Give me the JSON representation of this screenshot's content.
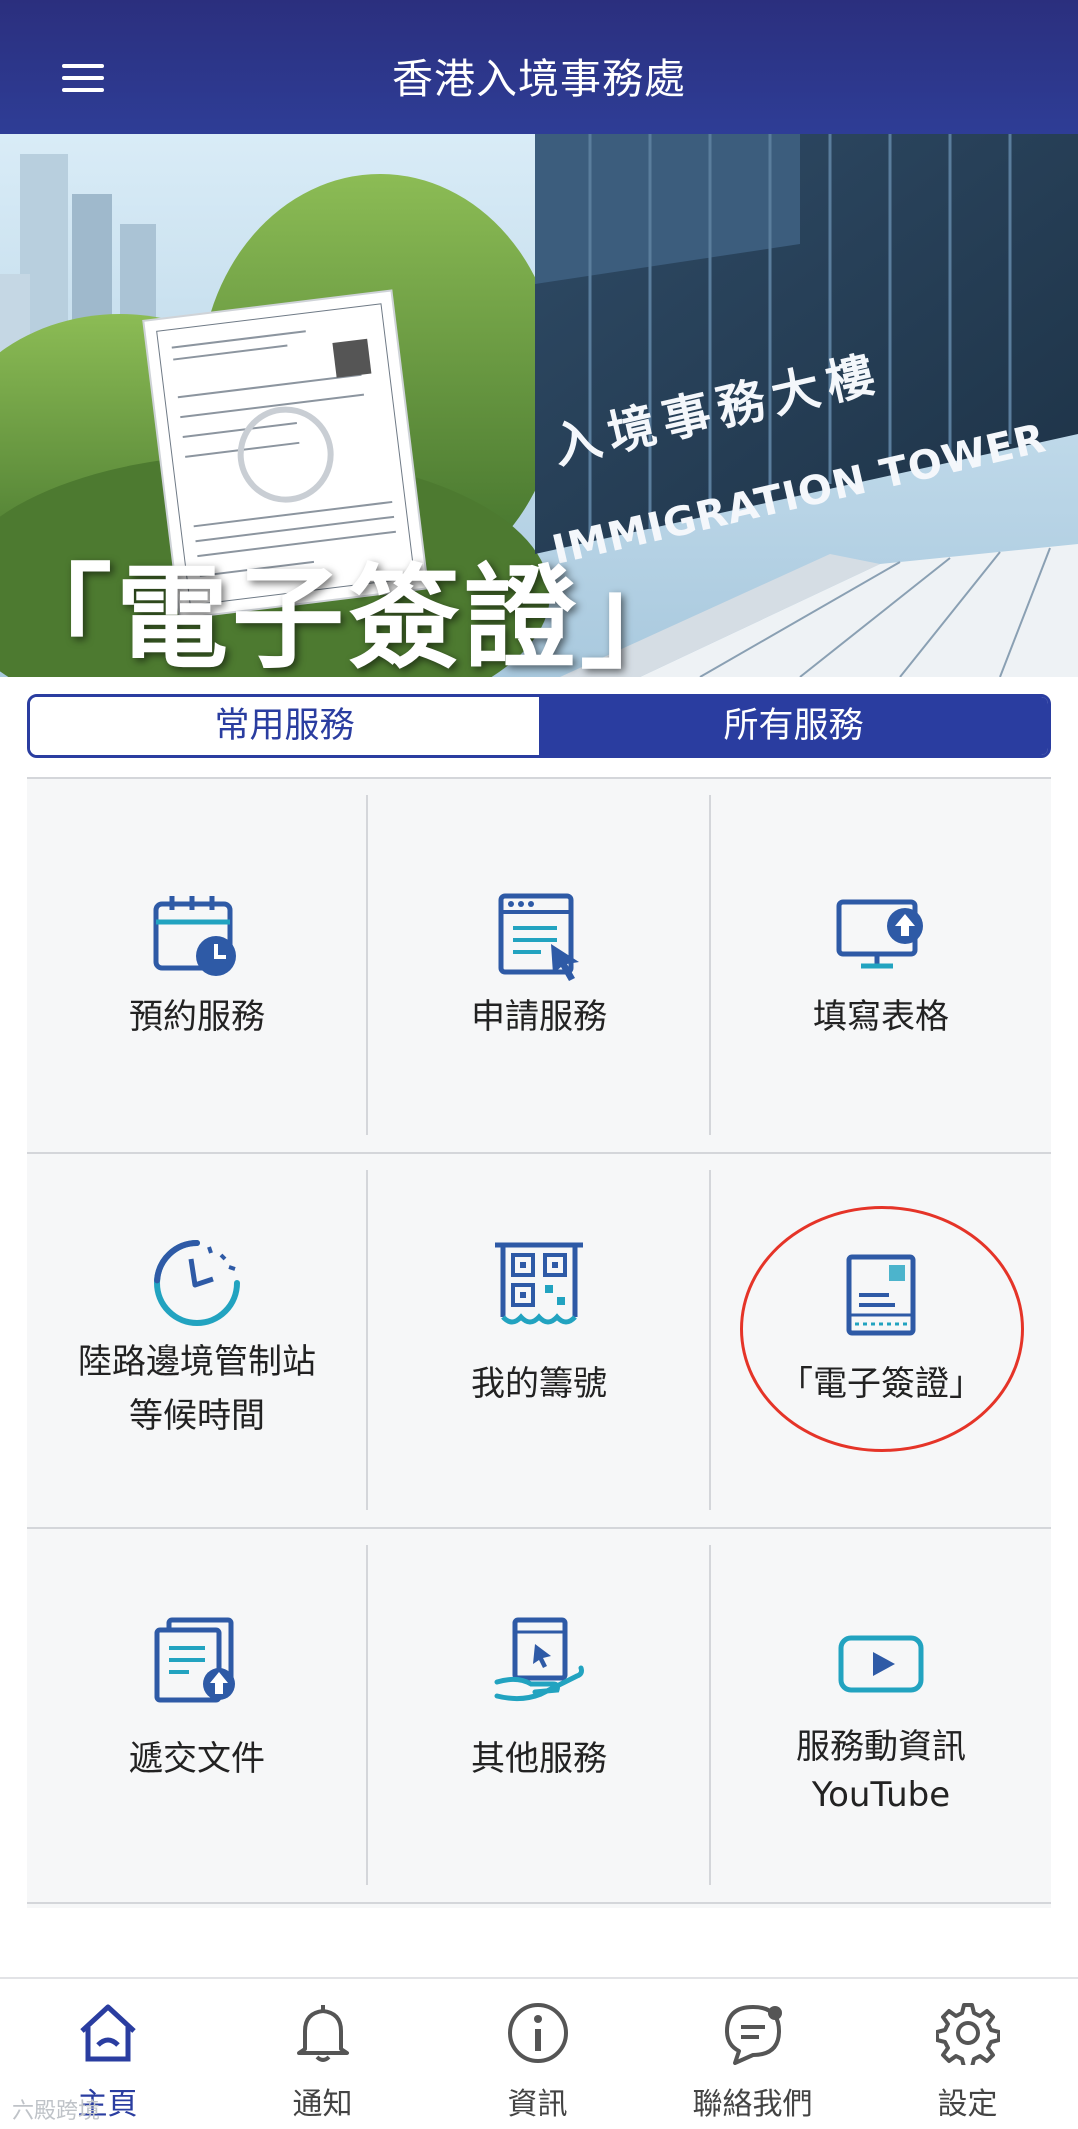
{
  "header": {
    "title": "香港入境事務處"
  },
  "banner": {
    "title": "「電子簽證」",
    "building_sign_cn": "入境事務大樓",
    "building_sign_en": "IMMIGRATION TOWER"
  },
  "tabs": [
    {
      "label": "常用服務",
      "selected": false
    },
    {
      "label": "所有服務",
      "selected": true
    }
  ],
  "services": [
    {
      "line1": "預約服務",
      "line2": "",
      "icon": "calendar-clock-icon"
    },
    {
      "line1": "申請服務",
      "line2": "",
      "icon": "browser-click-icon"
    },
    {
      "line1": "填寫表格",
      "line2": "",
      "icon": "monitor-upload-icon"
    },
    {
      "line1": "陸路邊境管制站",
      "line2": "等候時間",
      "icon": "timer-icon"
    },
    {
      "line1": "我的籌號",
      "line2": "",
      "icon": "qr-ticket-icon"
    },
    {
      "line1": "「電子簽證」",
      "line2": "",
      "icon": "evisa-document-icon"
    },
    {
      "line1": "遞交文件",
      "line2": "",
      "icon": "documents-upload-icon"
    },
    {
      "line1": "其他服務",
      "line2": "",
      "icon": "hand-tablet-icon"
    },
    {
      "line1": "服務動資訊",
      "line2": "YouTube",
      "icon": "play-video-icon"
    }
  ],
  "bottom_nav": [
    {
      "label": "主頁",
      "icon": "home-icon",
      "active": true
    },
    {
      "label": "通知",
      "icon": "bell-icon",
      "active": false
    },
    {
      "label": "資訊",
      "icon": "info-icon",
      "active": false
    },
    {
      "label": "聯絡我們",
      "icon": "chat-icon",
      "active": false
    },
    {
      "label": "設定",
      "icon": "gear-icon",
      "active": false
    }
  ],
  "watermark": "六殿跨境",
  "colors": {
    "header_bg": "#2e3d96",
    "accent": "#2a3da0",
    "icon_blue": "#2e5aa6",
    "icon_teal": "#22a3c0",
    "highlight": "#e53428"
  }
}
